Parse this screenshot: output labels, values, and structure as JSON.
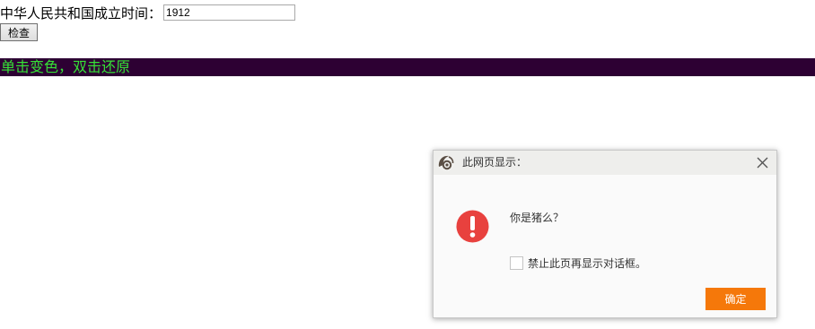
{
  "form": {
    "label": "中华人民共和国成立时间：",
    "year_value": "1912",
    "check_button_label": "检查"
  },
  "banner": {
    "text": "单击变色，双击还原",
    "background_color": "#2d0033",
    "text_color": "#36e236"
  },
  "dialog": {
    "title": "此网页显示：",
    "message": "你是猪么？",
    "suppress_label": "禁止此页再显示对话框。",
    "ok_label": "确定",
    "ok_color": "#f5780a",
    "icons": {
      "logo": "browser-logo-icon",
      "close": "close-icon",
      "alert": "exclamation-alert-icon"
    }
  }
}
